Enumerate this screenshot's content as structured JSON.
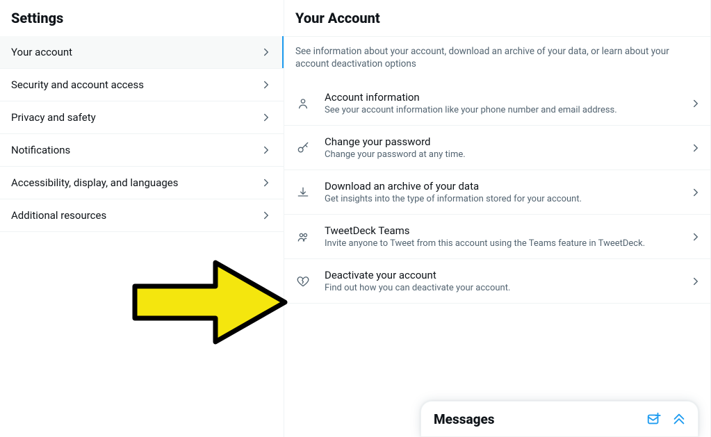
{
  "settings_title": "Settings",
  "nav": {
    "items": [
      {
        "label": "Your account",
        "selected": true
      },
      {
        "label": "Security and account access"
      },
      {
        "label": "Privacy and safety"
      },
      {
        "label": "Notifications"
      },
      {
        "label": "Accessibility, display, and languages"
      },
      {
        "label": "Additional resources"
      }
    ]
  },
  "account": {
    "title": "Your Account",
    "description": "See information about your account, download an archive of your data, or learn about your account deactivation options",
    "options": [
      {
        "title": "Account information",
        "subtitle": "See your account information like your phone number and email address."
      },
      {
        "title": "Change your password",
        "subtitle": "Change your password at any time."
      },
      {
        "title": "Download an archive of your data",
        "subtitle": "Get insights into the type of information stored for your account."
      },
      {
        "title": "TweetDeck Teams",
        "subtitle": "Invite anyone to Tweet from this account using the Teams feature in TweetDeck."
      },
      {
        "title": "Deactivate your account",
        "subtitle": "Find out how you can deactivate your account."
      }
    ]
  },
  "messages": {
    "title": "Messages"
  },
  "colors": {
    "accent": "#1d9bf0",
    "muted": "#536471",
    "arrow_fill": "#f4e60e"
  }
}
